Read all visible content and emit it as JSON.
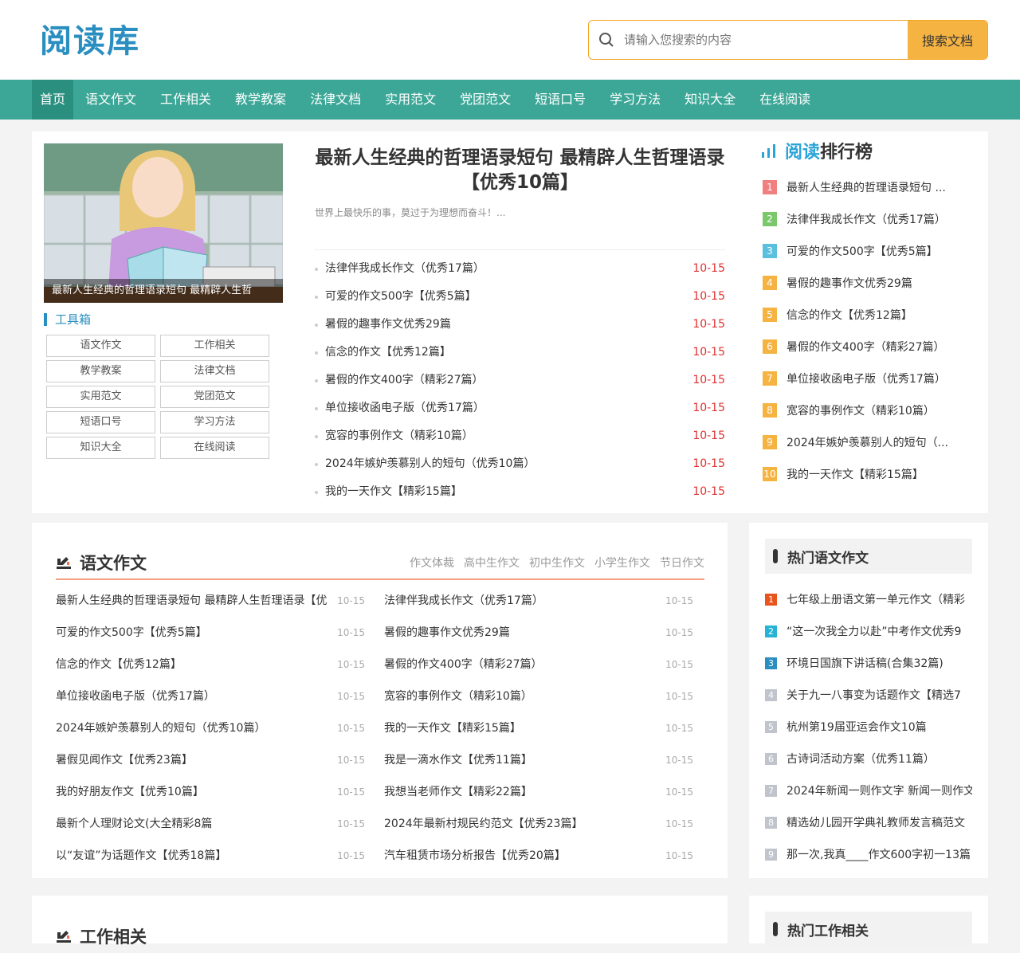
{
  "logo": "阅读库",
  "search": {
    "placeholder": "请输入您搜索的内容",
    "button": "搜索文档"
  },
  "nav": [
    "首页",
    "语文作文",
    "工作相关",
    "教学教案",
    "法律文档",
    "实用范文",
    "党团范文",
    "短语口号",
    "学习方法",
    "知识大全",
    "在线阅读"
  ],
  "feature": {
    "caption": "最新人生经典的哲理语录短句 最精辟人生哲",
    "title": "最新人生经典的哲理语录短句 最精辟人生哲理语录【优秀10篇】",
    "desc": "世界上最快乐的事，莫过于为理想而奋斗！..."
  },
  "toolbox": {
    "title": "工具箱",
    "items": [
      "语文作文",
      "工作相关",
      "教学教案",
      "法律文档",
      "实用范文",
      "党团范文",
      "短语口号",
      "学习方法",
      "知识大全",
      "在线阅读"
    ]
  },
  "main_list": [
    {
      "t": "法律伴我成长作文（优秀17篇）",
      "d": "10-15"
    },
    {
      "t": "可爱的作文500字【优秀5篇】",
      "d": "10-15"
    },
    {
      "t": "暑假的趣事作文优秀29篇",
      "d": "10-15"
    },
    {
      "t": "信念的作文【优秀12篇】",
      "d": "10-15"
    },
    {
      "t": "暑假的作文400字（精彩27篇）",
      "d": "10-15"
    },
    {
      "t": "单位接收函电子版（优秀17篇）",
      "d": "10-15"
    },
    {
      "t": "宽容的事例作文（精彩10篇）",
      "d": "10-15"
    },
    {
      "t": "2024年嫉妒羡慕别人的短句（优秀10篇）",
      "d": "10-15"
    },
    {
      "t": "我的一天作文【精彩15篇】",
      "d": "10-15"
    }
  ],
  "rank": {
    "title_hl": "阅读",
    "title_rest": "排行榜",
    "items": [
      "最新人生经典的哲理语录短句 ...",
      "法律伴我成长作文（优秀17篇）",
      "可爱的作文500字【优秀5篇】",
      "暑假的趣事作文优秀29篇",
      "信念的作文【优秀12篇】",
      "暑假的作文400字（精彩27篇）",
      "单位接收函电子版（优秀17篇）",
      "宽容的事例作文（精彩10篇）",
      "2024年嫉妒羡慕别人的短句（...",
      "我的一天作文【精彩15篇】"
    ],
    "colors": [
      "#f08080",
      "#7bc86c",
      "#5bc0de",
      "#f5b342",
      "#f5b342",
      "#f5b342",
      "#f5b342",
      "#f5b342",
      "#f5b342",
      "#f5b342"
    ]
  },
  "section": {
    "title": "语文作文",
    "tags": [
      "作文体裁",
      "高中生作文",
      "初中生作文",
      "小学生作文",
      "节日作文"
    ],
    "left": [
      {
        "t": "最新人生经典的哲理语录短句 最精辟人生哲理语录【优",
        "d": "10-15"
      },
      {
        "t": "可爱的作文500字【优秀5篇】",
        "d": "10-15"
      },
      {
        "t": "信念的作文【优秀12篇】",
        "d": "10-15"
      },
      {
        "t": "单位接收函电子版（优秀17篇）",
        "d": "10-15"
      },
      {
        "t": "2024年嫉妒羡慕别人的短句（优秀10篇）",
        "d": "10-15"
      },
      {
        "t": "暑假见闻作文【优秀23篇】",
        "d": "10-15"
      },
      {
        "t": "我的好朋友作文【优秀10篇】",
        "d": "10-15"
      },
      {
        "t": "最新个人理财论文(大全精彩8篇",
        "d": "10-15"
      },
      {
        "t": "以“友谊”为话题作文【优秀18篇】",
        "d": "10-15"
      }
    ],
    "right": [
      {
        "t": "法律伴我成长作文（优秀17篇）",
        "d": "10-15"
      },
      {
        "t": "暑假的趣事作文优秀29篇",
        "d": "10-15"
      },
      {
        "t": "暑假的作文400字（精彩27篇）",
        "d": "10-15"
      },
      {
        "t": "宽容的事例作文（精彩10篇）",
        "d": "10-15"
      },
      {
        "t": "我的一天作文【精彩15篇】",
        "d": "10-15"
      },
      {
        "t": "我是一滴水作文【优秀11篇】",
        "d": "10-15"
      },
      {
        "t": "我想当老师作文【精彩22篇】",
        "d": "10-15"
      },
      {
        "t": "2024年最新村规民约范文【优秀23篇】",
        "d": "10-15"
      },
      {
        "t": "汽车租赁市场分析报告【优秀20篇】",
        "d": "10-15"
      }
    ]
  },
  "hot": {
    "title": "热门语文作文",
    "items": [
      "七年级上册语文第一单元作文（精彩",
      "“这一次我全力以赴”中考作文优秀9",
      "环境日国旗下讲话稿(合集32篇)",
      "关于九一八事变为话题作文【精选7",
      "杭州第19届亚运会作文10篇",
      "古诗词活动方案（优秀11篇）",
      "2024年新闻一则作文字 新闻一则作文",
      "精选幼儿园开学典礼教师发言稿范文",
      "那一次,我真____作文600字初一13篇"
    ],
    "colors": [
      "#e8541c",
      "#26b3d6",
      "#2a8fc0",
      "#c0c4cc",
      "#c0c4cc",
      "#c0c4cc",
      "#c0c4cc",
      "#c0c4cc",
      "#c0c4cc"
    ]
  },
  "section2": {
    "title": "工作相关"
  },
  "hot2": {
    "title": "热门工作相关"
  }
}
